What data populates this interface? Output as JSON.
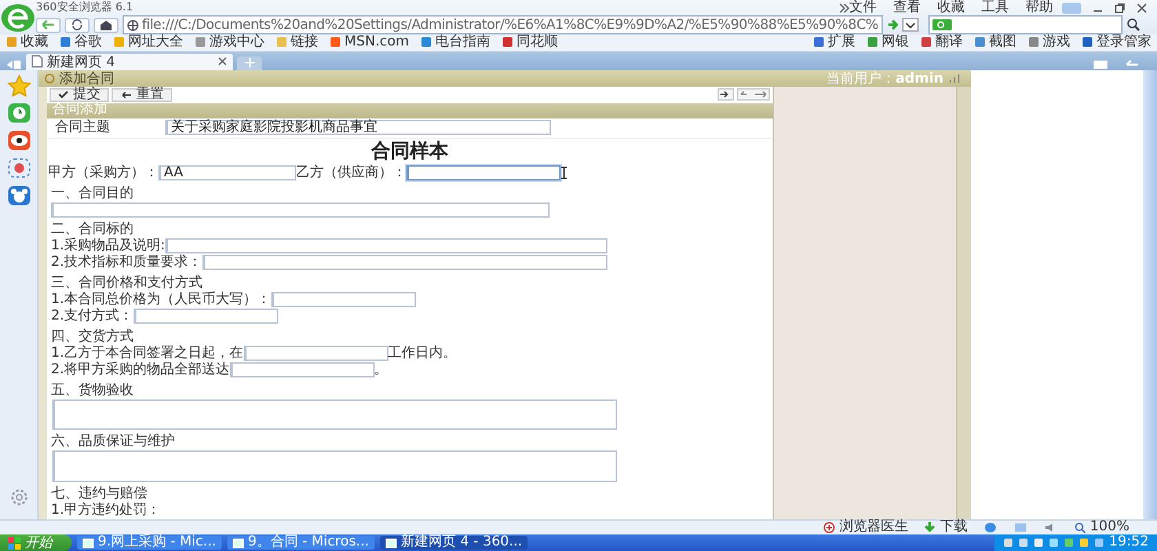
{
  "browser": {
    "title": "360安全浏览器 6.1",
    "menu": [
      "文件",
      "查看",
      "收藏",
      "工具",
      "帮助"
    ],
    "address": "file:///C:/Documents%20and%20Settings/Administrator/%E6%A1%8C%E9%9D%A2/%E5%90%88%E5%90%8C%"
  },
  "bookmarks": {
    "left": [
      "收藏",
      "谷歌",
      "网址大全",
      "游戏中心",
      "链接",
      "MSN.com",
      "电台指南",
      "同花顺"
    ],
    "right": [
      "扩展",
      "网银",
      "翻译",
      "截图",
      "游戏",
      "登录管家"
    ]
  },
  "tabs": [
    {
      "label": "新建网页 4",
      "selected": true
    }
  ],
  "page": {
    "header": "添加合同",
    "user": "当前用户：**admin**",
    "buttons": [
      "提交",
      "重置"
    ],
    "section": "合同添加"
  },
  "form": {
    "subject": {
      "label": "合同主题",
      "value": "关于采购家庭影院投影机商品事宜"
    },
    "title": "合同样本",
    "parties": [
      {
        "label": "甲方（采购方）：",
        "value": "AA",
        "focused": false
      },
      {
        "label": "乙方（供应商）：",
        "focused": true
      }
    ],
    "sections": [
      {
        "heading": "一、合同目的",
        "rows": [
          {
            "kind": "line"
          }
        ]
      },
      {
        "heading": "二、合同标的",
        "rows": [
          {
            "kind": "line",
            "label": "1.采购物品及说明:"
          },
          {
            "kind": "line",
            "label": "2.技术指标和质量要求："
          }
        ]
      },
      {
        "heading": "三、合同价格和支付方式",
        "rows": [
          {
            "kind": "short",
            "label": "1.本合同总价格为（人民币大写）："
          },
          {
            "kind": "short",
            "label": "2.支付方式："
          }
        ]
      },
      {
        "heading": "四、交货方式",
        "rows": [
          {
            "kind": "short",
            "label": "1.乙方于本合同签署之日起，在",
            "suffix": "工作日内。"
          },
          {
            "kind": "short",
            "label": "2.将甲方采购的物品全部送达",
            "suffix": "。"
          }
        ]
      },
      {
        "heading": "五、货物验收",
        "rows": [
          {
            "kind": "area"
          }
        ]
      },
      {
        "heading": "六、品质保证与维护",
        "rows": [
          {
            "kind": "area"
          }
        ]
      },
      {
        "heading": "七、违约与赔偿",
        "rows": [
          {
            "kind": "text",
            "label": "1.甲方违约处罚："
          }
        ]
      }
    ]
  },
  "status": [
    "浏览器医生",
    "下载",
    "100%"
  ],
  "taskbar": {
    "start": "开始",
    "tasks": [
      {
        "label": "9.网上采购 - Mic...",
        "selected": false
      },
      {
        "label": "9。合同 - Micros...",
        "selected": false
      },
      {
        "label": "新建网页 4 - 360...",
        "selected": true
      }
    ],
    "clock": "19:52"
  }
}
